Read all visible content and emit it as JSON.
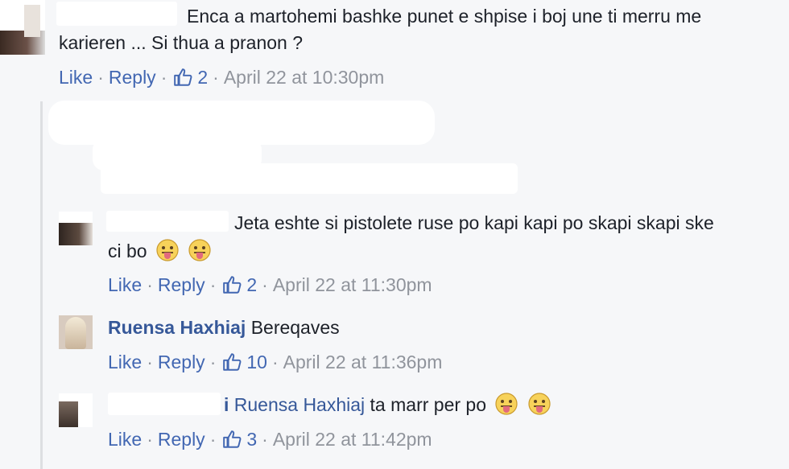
{
  "comments": [
    {
      "text_line1": "Enca a martohemi bashke punet e shpise i boj une ti merru me",
      "text_line2": "karieren ... Si thua a pranon ?",
      "like_label": "Like",
      "reply_label": "Reply",
      "reaction_count": "2",
      "timestamp": "April 22 at 10:30pm"
    }
  ],
  "replies": [
    {
      "text_line1": "Jeta eshte si pistolete ruse po kapi kapi po skapi skapi ske",
      "text_line2": "ci bo",
      "like_label": "Like",
      "reply_label": "Reply",
      "reaction_count": "2",
      "timestamp": "April 22 at 11:30pm"
    },
    {
      "author": "Ruensa Haxhiaj",
      "text": "Bereqaves",
      "like_label": "Like",
      "reply_label": "Reply",
      "reaction_count": "10",
      "timestamp": "April 22 at 11:36pm"
    },
    {
      "name_fragment": "i",
      "mention": "Ruensa Haxhiaj",
      "text": "ta marr per po",
      "like_label": "Like",
      "reply_label": "Reply",
      "reaction_count": "3",
      "timestamp": "April 22 at 11:42pm"
    }
  ],
  "separator": "·",
  "icons": {
    "like": "thumbs-up-icon",
    "emoji": "tongue-out-emoji-icon"
  },
  "colors": {
    "link": "#4267b2",
    "name": "#365899",
    "meta": "#90949c",
    "text": "#1d2129",
    "background": "#f6f7f9"
  }
}
